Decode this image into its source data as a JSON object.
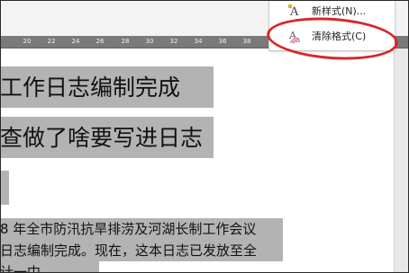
{
  "ruler": {
    "numbers": [
      "20",
      "22",
      "24",
      "26",
      "28",
      "30",
      "32",
      "34",
      "36",
      "38"
    ]
  },
  "document": {
    "heading_line_1": "工作日志编制完成",
    "heading_line_2": "查做了啥要写进日志",
    "body_line_1": "8 年全市防汛抗旱排涝及河湖长制工作会议",
    "body_line_2": "日志编制完成。现在，这本日志已发放至全",
    "body_line_3": "计一中"
  },
  "styles_menu": {
    "new_style_label": "新样式(N)...",
    "clear_format_label": "清除格式(C)",
    "new_style_icon": "new-style-icon",
    "clear_format_icon": "clear-format-icon"
  },
  "annotation": {
    "highlight_color": "#d8262a",
    "highlighted_item": "clear_format"
  },
  "colors": {
    "selection": "#b3b3b3",
    "ruler_bg": "#7a7a7a"
  }
}
